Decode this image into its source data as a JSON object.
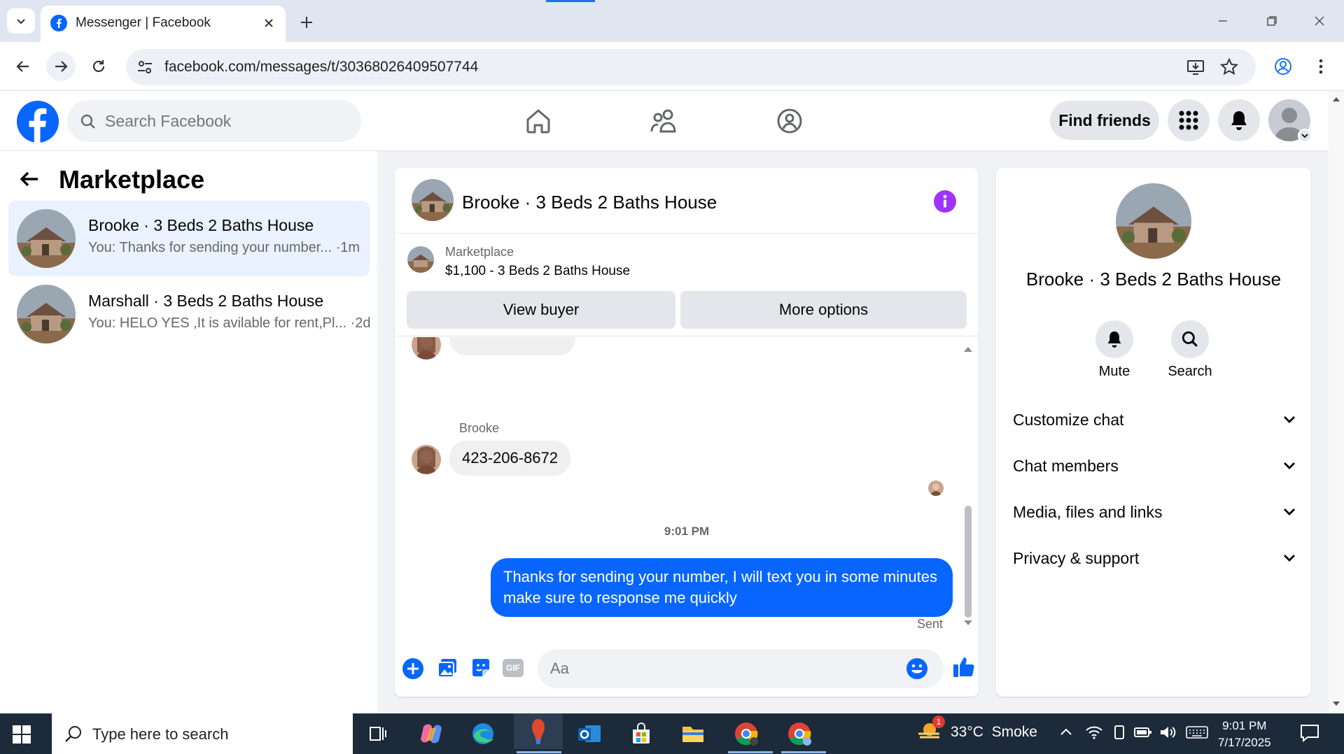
{
  "browser": {
    "tab_title": "Messenger | Facebook",
    "url": "facebook.com/messages/t/30368026409507744"
  },
  "fb_header": {
    "search_placeholder": "Search Facebook",
    "find_friends_label": "Find friends"
  },
  "sidebar": {
    "title": "Marketplace",
    "conversations": [
      {
        "name": "Brooke · 3 Beds 2 Baths House",
        "preview": "You: Thanks for sending your number...",
        "time": "·1m",
        "active": true
      },
      {
        "name": "Marshall · 3 Beds 2 Baths House",
        "preview": "You: HELO YES ,It is avilable for rent,Pl...",
        "time": "·2d",
        "active": false
      }
    ]
  },
  "chat": {
    "title": "Brooke · 3 Beds 2 Baths House",
    "listing": {
      "source": "Marketplace",
      "title": "$1,100 - 3 Beds 2 Baths House",
      "view_buyer_label": "View buyer",
      "more_options_label": "More options"
    },
    "messages": [
      {
        "sender": "Brooke",
        "text": "423-206-8672",
        "direction": "incoming"
      },
      {
        "timestamp": "9:01 PM"
      },
      {
        "sender": "You",
        "text": "Thanks for sending your number, I will text you in some minutes make sure to response me quickly",
        "direction": "outgoing",
        "status": "Sent"
      }
    ],
    "composer_placeholder": "Aa",
    "gif_label": "GIF"
  },
  "info_panel": {
    "name": "Brooke · 3 Beds 2 Baths House",
    "actions": [
      "Mute",
      "Search"
    ],
    "sections": [
      "Customize chat",
      "Chat members",
      "Media, files and links",
      "Privacy & support"
    ]
  },
  "taskbar": {
    "search_placeholder": "Type here to search",
    "weather": "33°C  Smoke",
    "weather_badge": "1",
    "time": "9:01 PM",
    "date": "7/17/2025"
  },
  "colors": {
    "facebook_blue": "#0866ff",
    "info_purple": "#a033ff",
    "active_conversation_bg": "#e9f2fe"
  }
}
